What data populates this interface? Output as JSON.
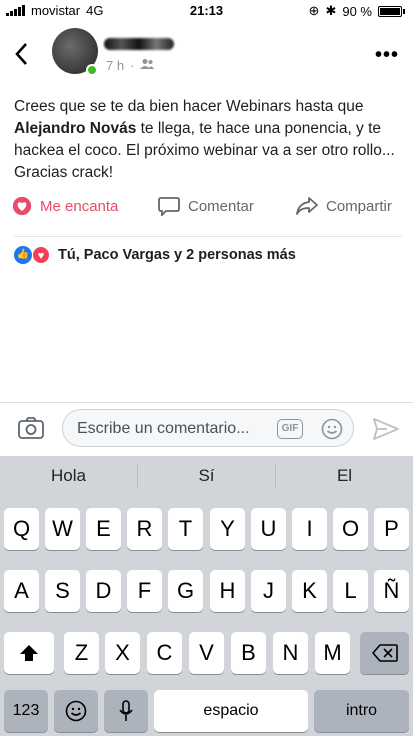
{
  "status_bar": {
    "carrier": "movistar",
    "network": "4G",
    "time": "21:13",
    "battery": "90 %"
  },
  "post": {
    "time_ago": "7 h",
    "text_before": "Crees que se te da bien hacer Webinars hasta que ",
    "mention": "Alejandro Novás",
    "text_after": " te llega, te hace una ponencia, y te hackea el coco. El próximo webinar va a ser otro rollo... Gracias crack!"
  },
  "actions": {
    "love": "Me encanta",
    "comment": "Comentar",
    "share": "Compartir"
  },
  "reactions": {
    "summary": "Tú, Paco Vargas y 2 personas más"
  },
  "composer": {
    "placeholder": "Escribe un comentario...",
    "gif": "GIF"
  },
  "keyboard": {
    "suggestions": [
      "Hola",
      "Sí",
      "El"
    ],
    "row1": [
      "Q",
      "W",
      "E",
      "R",
      "T",
      "Y",
      "U",
      "I",
      "O",
      "P"
    ],
    "row2": [
      "A",
      "S",
      "D",
      "F",
      "G",
      "H",
      "J",
      "K",
      "L",
      "Ñ"
    ],
    "row3": [
      "Z",
      "X",
      "C",
      "V",
      "B",
      "N",
      "M"
    ],
    "numbers": "123",
    "space": "espacio",
    "return": "intro"
  },
  "colors": {
    "love": "#e84d67",
    "like_blue": "#1877f2",
    "online": "#42b72a"
  }
}
